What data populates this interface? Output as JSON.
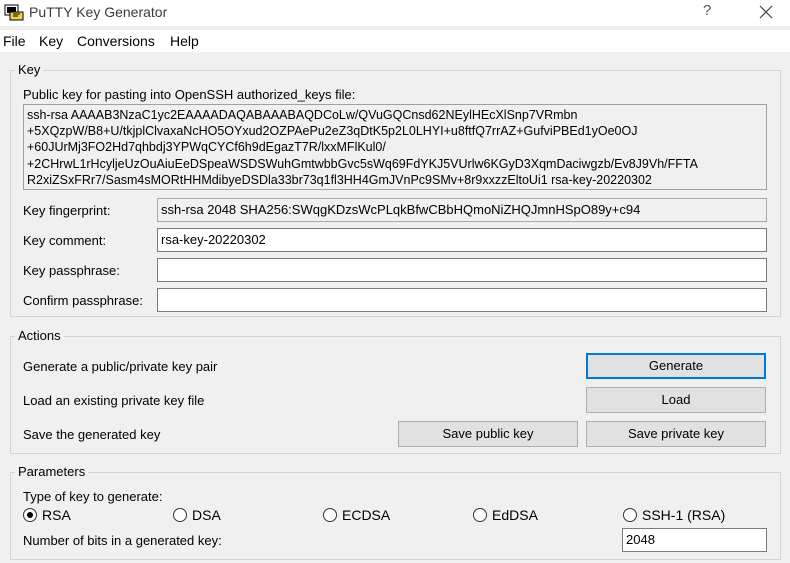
{
  "window": {
    "title": "PuTTY Key Generator",
    "help_glyph": "?",
    "close_glyph": "✕"
  },
  "menu": {
    "items": [
      "File",
      "Key",
      "Conversions",
      "Help"
    ]
  },
  "key_group": {
    "label": "Key",
    "public_key_label": "Public key for pasting into OpenSSH authorized_keys file:",
    "public_key_lines": [
      "ssh-rsa AAAAB3NzaC1yc2EAAAADAQABAAABAQDCoLw/QVuGQCnsd62NEylHEcXlSnp7VRmbn",
      "+5XQzpW/B8+U/tkjplClvaxaNcHO5OYxud2OZPAePu2eZ3qDtK5p2L0LHYI+u8ftfQ7rrAZ+GufviPBEd1yOe0OJ",
      "+60JUrMj3FO2Hd7qhbdj3YPWqCYCf6h9dEgazT7R/lxxMFlKul0/",
      "+2CHrwL1rHcyljeUzOuAiuEeDSpeaWSDSWuhGmtwbbGvc5sWq69FdYKJ5VUrlw6KGyD3XqmDaciwgzb/Ev8J9Vh/FFTA",
      "R2xiZSxFRr7/Sasm4sMORtHHMdibyeDSDla33br73q1fl3HH4GmJVnPc9SMv+8r9xxzzEltoUi1 rsa-key-20220302"
    ],
    "fingerprint_label": "Key fingerprint:",
    "fingerprint_value": "ssh-rsa 2048 SHA256:SWqgKDzsWcPLqkBfwCBbHQmoNiZHQJmnHSpO89y+c94",
    "comment_label": "Key comment:",
    "comment_value": "rsa-key-20220302",
    "passphrase_label": "Key passphrase:",
    "passphrase_value": "",
    "confirm_label": "Confirm passphrase:",
    "confirm_value": ""
  },
  "actions_group": {
    "label": "Actions",
    "generate_text": "Generate a public/private key pair",
    "generate_button": "Generate",
    "load_text": "Load an existing private key file",
    "load_button": "Load",
    "save_text": "Save the generated key",
    "save_public_button": "Save public key",
    "save_private_button": "Save private key"
  },
  "params_group": {
    "label": "Parameters",
    "type_label": "Type of key to generate:",
    "key_types": [
      {
        "label": "RSA",
        "checked": true
      },
      {
        "label": "DSA",
        "checked": false
      },
      {
        "label": "ECDSA",
        "checked": false
      },
      {
        "label": "EdDSA",
        "checked": false
      },
      {
        "label": "SSH-1 (RSA)",
        "checked": false
      }
    ],
    "bits_label": "Number of bits in a generated key:",
    "bits_value": "2048"
  },
  "colors": {
    "default_button_border": "#0078d7",
    "window_bg": "#f0f0f0"
  }
}
